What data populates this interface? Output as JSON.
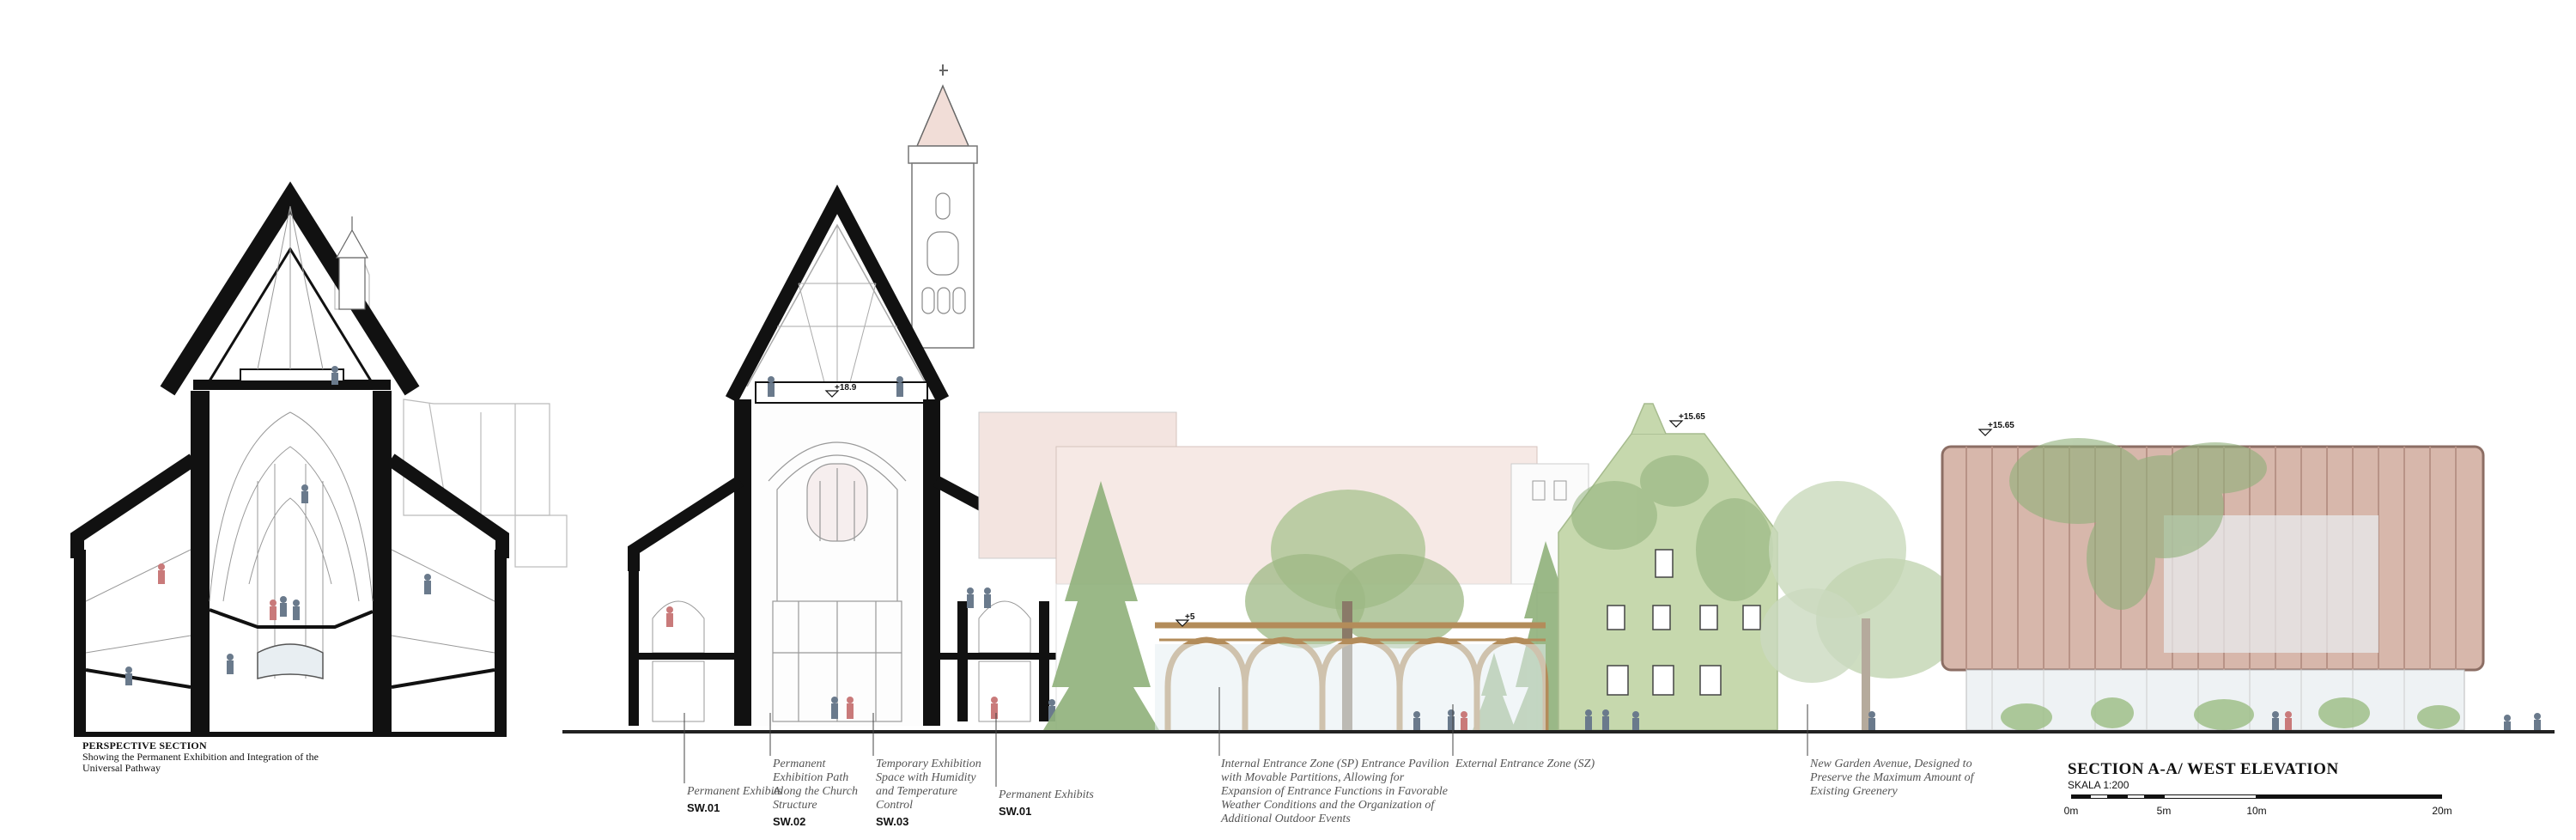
{
  "perspective_caption": {
    "title": "PERSPECTIVE SECTION",
    "text": "Showing the Permanent Exhibition and Integration of the Universal Pathway"
  },
  "annotations": {
    "sw01_a": {
      "text": "Permanent Exhibits",
      "code": "SW.01"
    },
    "sw02": {
      "text": "Permanent Exhibition Path Along the Church Structure",
      "code": "SW.02"
    },
    "sw03": {
      "text": "Temporary Exhibition Space with Humidity and Temperature Control",
      "code": "SW.03"
    },
    "sw01_b": {
      "text": "Permanent Exhibits",
      "code": "SW.01"
    },
    "internal_zone": "Internal Entrance Zone (SP) Entrance Pavilion with Movable Partitions, Allowing for Expansion of Entrance Functions in Favorable Weather Conditions and the Organization of Additional Outdoor Events",
    "external_zone": "External Entrance Zone (SZ)",
    "garden_avenue": "New Garden Avenue, Designed to Preserve the Maximum Amount of Existing Greenery"
  },
  "levels": {
    "church": "+18.9",
    "pavilion": "+5",
    "house": "+15.65",
    "museum": "+15.65"
  },
  "title_block": {
    "title": "SECTION A-A/ WEST ELEVATION",
    "scale": "SKALA 1:200"
  },
  "scale_bar": {
    "labels": [
      "0m",
      "5m",
      "10m",
      "20m"
    ],
    "values_m": [
      0,
      5,
      10,
      20
    ]
  },
  "colors": {
    "poche": "#111111",
    "roof_pink": "#f3e4e0",
    "tree_green": "#8fb07a",
    "ivy_green": "#b8cf9c",
    "timber_arch": "#b38c5a",
    "copper_facade": "#c9a597",
    "ground": "#222222"
  }
}
